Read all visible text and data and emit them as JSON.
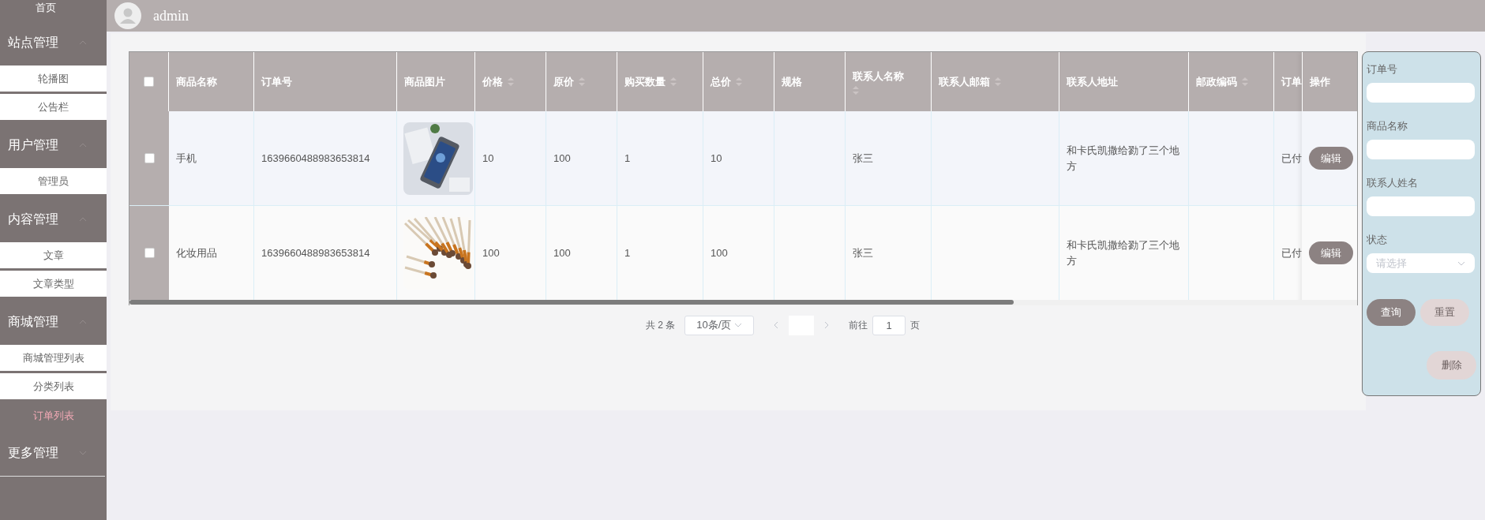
{
  "header": {
    "username": "admin"
  },
  "sidebar": {
    "items": [
      {
        "kind": "link",
        "label": "首页"
      },
      {
        "kind": "group",
        "label": "站点管理",
        "expanded": true,
        "children": [
          {
            "label": "轮播图",
            "selected": false
          },
          {
            "label": "公告栏",
            "selected": false
          }
        ]
      },
      {
        "kind": "group",
        "label": "用户管理",
        "expanded": true,
        "children": [
          {
            "label": "管理员",
            "selected": false
          }
        ]
      },
      {
        "kind": "group",
        "label": "内容管理",
        "expanded": true,
        "children": [
          {
            "label": "文章",
            "selected": false
          },
          {
            "label": "文章类型",
            "selected": false
          }
        ]
      },
      {
        "kind": "group",
        "label": "商城管理",
        "expanded": true,
        "children": [
          {
            "label": "商城管理列表",
            "selected": false
          },
          {
            "label": "分类列表",
            "selected": false
          },
          {
            "label": "订单列表",
            "selected": true
          }
        ]
      },
      {
        "kind": "group",
        "label": "更多管理",
        "expanded": false
      }
    ]
  },
  "table": {
    "header_checked": false,
    "columns": [
      {
        "label": "商品名称",
        "sortable": false
      },
      {
        "label": "订单号",
        "sortable": false
      },
      {
        "label": "商品图片",
        "sortable": false
      },
      {
        "label": "价格",
        "sortable": true
      },
      {
        "label": "原价",
        "sortable": true
      },
      {
        "label": "购买数量",
        "sortable": true
      },
      {
        "label": "总价",
        "sortable": true
      },
      {
        "label": "规格",
        "sortable": false
      },
      {
        "label": "联系人名称",
        "sortable": true
      },
      {
        "label": "联系人邮箱",
        "sortable": true
      },
      {
        "label": "联系人地址",
        "sortable": false
      },
      {
        "label": "邮政编码",
        "sortable": true
      },
      {
        "label": "订单"
      }
    ],
    "action_column": "操作",
    "rows": [
      {
        "checked": false,
        "action": "编辑",
        "cells": [
          {
            "kind": "text",
            "text": "手机"
          },
          {
            "kind": "text",
            "text": "1639660488983653814"
          },
          {
            "kind": "picture"
          },
          {
            "kind": "text",
            "text": "10"
          },
          {
            "kind": "text",
            "text": "100"
          },
          {
            "kind": "text",
            "text": "1"
          },
          {
            "kind": "text",
            "text": "10"
          },
          {
            "kind": "empty"
          },
          {
            "kind": "text",
            "text": "张三"
          },
          {
            "kind": "empty"
          },
          {
            "kind": "text",
            "text": "和卡氏凯撒给勠了三个地方"
          },
          {
            "kind": "empty"
          },
          {
            "kind": "text",
            "text": "已付"
          }
        ]
      },
      {
        "checked": false,
        "action": "编辑",
        "cells": [
          {
            "kind": "text",
            "text": "化妆用品"
          },
          {
            "kind": "text",
            "text": "1639660488983653814"
          },
          {
            "kind": "picture"
          },
          {
            "kind": "text",
            "text": "100"
          },
          {
            "kind": "text",
            "text": "100"
          },
          {
            "kind": "text",
            "text": "1"
          },
          {
            "kind": "text",
            "text": "100"
          },
          {
            "kind": "empty"
          },
          {
            "kind": "text",
            "text": "张三"
          },
          {
            "kind": "empty"
          },
          {
            "kind": "text",
            "text": "和卡氏凯撒给勠了三个地方"
          },
          {
            "kind": "empty"
          },
          {
            "kind": "text",
            "text": "已付"
          }
        ]
      }
    ]
  },
  "pagination": {
    "total": "共 2 条",
    "page_size": "10条/页",
    "jump_label": "前往",
    "page": "1",
    "page_suffix": "页"
  },
  "search_panel": {
    "fields": [
      {
        "kind": "input",
        "label": "订单号"
      },
      {
        "kind": "input",
        "label": "商品名称"
      },
      {
        "kind": "input",
        "label": "联系人姓名"
      },
      {
        "kind": "select",
        "label": "状态",
        "placeholder": "请选择"
      }
    ],
    "buttons": [
      {
        "kind": "primary",
        "label": "查询"
      },
      {
        "kind": "muted",
        "label": "重置"
      }
    ],
    "delete_button": {
      "kind": "muted",
      "label": "删除"
    }
  }
}
